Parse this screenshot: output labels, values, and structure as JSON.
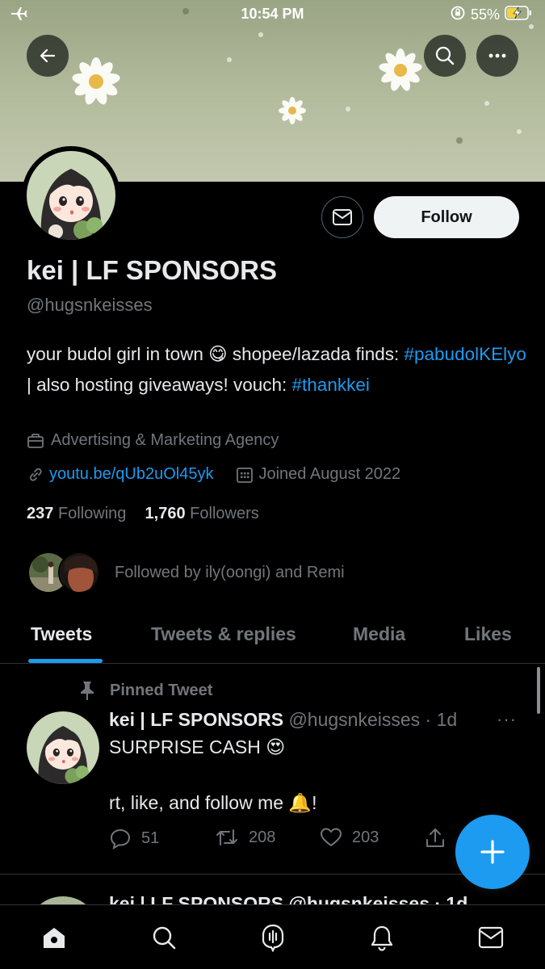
{
  "status_bar": {
    "time": "10:54 PM",
    "battery": "55%"
  },
  "profile": {
    "name": "kei | LF SPONSORS",
    "handle": "@hugsnkeisses",
    "follow_label": "Follow",
    "bio_part1": "your budol girl in town ",
    "bio_emoji": "😋",
    "bio_part2": " shopee/lazada finds: ",
    "bio_tag1": "#pabudolKElyo",
    "bio_part3": " | also hosting giveaways! vouch: ",
    "bio_tag2": "#thankkei",
    "category": "Advertising & Marketing Agency",
    "link": "youtu.be/qUb2uOl45yk",
    "joined": "Joined August 2022",
    "following_count": "237",
    "following_label": "Following",
    "followers_count": "1,760",
    "followers_label": "Followers",
    "followed_by": "Followed by ily(oongi) and Remi"
  },
  "tabs": [
    {
      "label": "Tweets",
      "active": true
    },
    {
      "label": "Tweets & replies",
      "active": false
    },
    {
      "label": "Media",
      "active": false
    },
    {
      "label": "Likes",
      "active": false
    }
  ],
  "tweet": {
    "pinned_label": "Pinned Tweet",
    "author_name": "kei | LF SPONSORS",
    "author_meta": "@hugsnkeisses · 1d",
    "text_line1": "SURPRISE CASH ",
    "text_line1_emoji": "😍",
    "text_line2": "rt, like, and follow me ",
    "text_line2_emoji": "🔔",
    "text_line2_end": "!",
    "replies": "51",
    "retweets": "208",
    "likes": "203"
  },
  "partial_tweet": {
    "text": "kei | LF SPONSORS @hugsnkeisses · 1d"
  },
  "colors": {
    "accent": "#1d9bf0",
    "background": "#000000",
    "muted": "#71767b",
    "text": "#e7e9ea"
  },
  "icons": {
    "back": "arrow-left-icon",
    "search": "search-icon",
    "more": "more-icon",
    "message": "envelope-icon",
    "compose": "plus-icon",
    "nav": [
      "home-icon",
      "search-icon",
      "spaces-icon",
      "bell-icon",
      "envelope-icon"
    ]
  }
}
